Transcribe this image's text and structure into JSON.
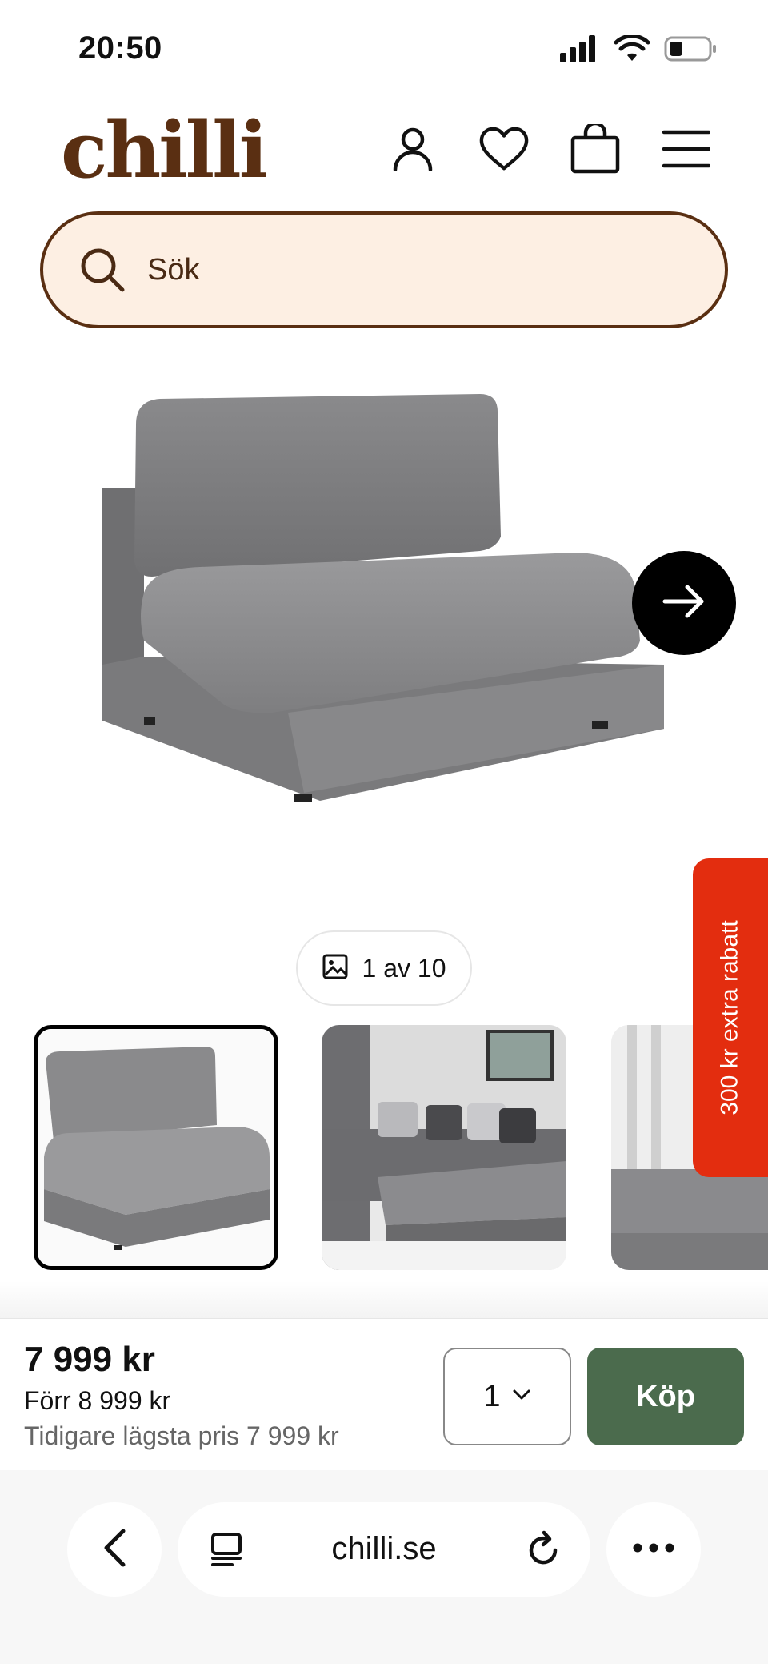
{
  "status_bar": {
    "time": "20:50"
  },
  "header": {
    "logo": "chilli"
  },
  "search": {
    "placeholder": "Sök"
  },
  "gallery": {
    "counter": "1 av 10",
    "thumbnails": [
      "thumbnail-1",
      "thumbnail-2",
      "thumbnail-3"
    ]
  },
  "promo": {
    "side_label": "300 kr extra rabatt"
  },
  "purchase": {
    "price": "7 999 kr",
    "previous_price": "Förr 8 999 kr",
    "lowest_price": "Tidigare lägsta pris 7 999 kr",
    "quantity": "1",
    "buy_label": "Köp"
  },
  "browser": {
    "url": "chilli.se"
  },
  "colors": {
    "brand_brown": "#5a2f12",
    "search_bg": "#fdefe3",
    "buy_green": "#4b6b4d",
    "promo_red": "#e32d0f"
  },
  "icons": [
    "signal-icon",
    "wifi-icon",
    "battery-icon",
    "user-icon",
    "heart-icon",
    "bag-icon",
    "menu-icon",
    "search-icon",
    "arrow-right-icon",
    "image-icon",
    "chevron-down-icon",
    "chevron-left-icon",
    "tabs-icon",
    "reload-icon",
    "more-icon"
  ]
}
